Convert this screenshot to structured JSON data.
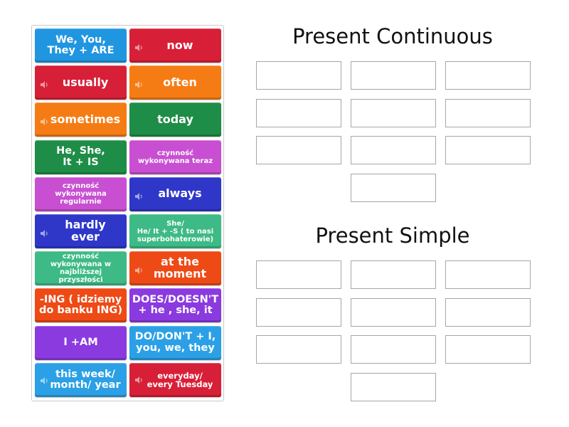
{
  "tiles": [
    {
      "label": "We, You, They + ARE",
      "lines": [
        "We, You,",
        "They + ARE"
      ],
      "color": "#2196e0",
      "speaker": false
    },
    {
      "label": "now",
      "lines": [
        "now"
      ],
      "color": "#d81f38",
      "speaker": true
    },
    {
      "label": "usually",
      "lines": [
        "usually"
      ],
      "color": "#d81f38",
      "speaker": true
    },
    {
      "label": "often",
      "lines": [
        "often"
      ],
      "color": "#f57c14",
      "speaker": true
    },
    {
      "label": "sometimes",
      "lines": [
        "sometimes"
      ],
      "color": "#f57c14",
      "speaker": true
    },
    {
      "label": "today",
      "lines": [
        "today"
      ],
      "color": "#1e8d47",
      "speaker": false
    },
    {
      "label": "He, She, It + IS",
      "lines": [
        "He, She,",
        "It + IS"
      ],
      "color": "#1e8d47",
      "speaker": false
    },
    {
      "label": "czynność wykonywana teraz",
      "lines": [
        "czynność",
        "wykonywana teraz"
      ],
      "color": "#c84fd2",
      "speaker": false
    },
    {
      "label": "czynność wykonywana regularnie",
      "lines": [
        "czynność",
        "wykonywana",
        "regularnie"
      ],
      "color": "#c84fd2",
      "speaker": false
    },
    {
      "label": "always",
      "lines": [
        "always"
      ],
      "color": "#2f37c9",
      "speaker": true
    },
    {
      "label": "hardly ever",
      "lines": [
        "hardly",
        "ever"
      ],
      "color": "#2f37c9",
      "speaker": true
    },
    {
      "label": "She/ He/ It + -S ( to nasi superbohaterowie)",
      "lines": [
        "She/",
        "He/ It + -S ( to nasi",
        "superbohaterowie)"
      ],
      "color": "#3dba85",
      "speaker": false
    },
    {
      "label": "czynność wykonywana w najbliższej przyszłości",
      "lines": [
        "czynność",
        "wykonywana w",
        "najbliższej przyszłości"
      ],
      "color": "#3dba85",
      "speaker": false
    },
    {
      "label": "at the moment",
      "lines": [
        "at the",
        "moment"
      ],
      "color": "#ee4a16",
      "speaker": true
    },
    {
      "label": "-ING ( idziemy do banku ING)",
      "lines": [
        "-ING ( idziemy",
        "do banku ING)"
      ],
      "color": "#ee4a16",
      "speaker": false
    },
    {
      "label": "DOES/DOESN'T + he , she, it",
      "lines": [
        "DOES/DOESN'T",
        "+ he , she, it"
      ],
      "color": "#8b3ae0",
      "speaker": false
    },
    {
      "label": "I +AM",
      "lines": [
        "I +AM"
      ],
      "color": "#8b3ae0",
      "speaker": false
    },
    {
      "label": "DO/DON'T + I, you, we, they",
      "lines": [
        "DO/DON'T + I,",
        "you, we, they"
      ],
      "color": "#2ba0e6",
      "speaker": false
    },
    {
      "label": "this week/ month/ year",
      "lines": [
        "this week/",
        "month/ year"
      ],
      "color": "#2ba0e6",
      "speaker": true
    },
    {
      "label": "everyday/ every Tuesday",
      "lines": [
        "everyday/",
        "every Tuesday"
      ],
      "color": "#d81f38",
      "speaker": true
    }
  ],
  "groups": [
    {
      "title": "Present Continuous",
      "slot_count": 10
    },
    {
      "title": "Present Simple",
      "slot_count": 10
    }
  ]
}
